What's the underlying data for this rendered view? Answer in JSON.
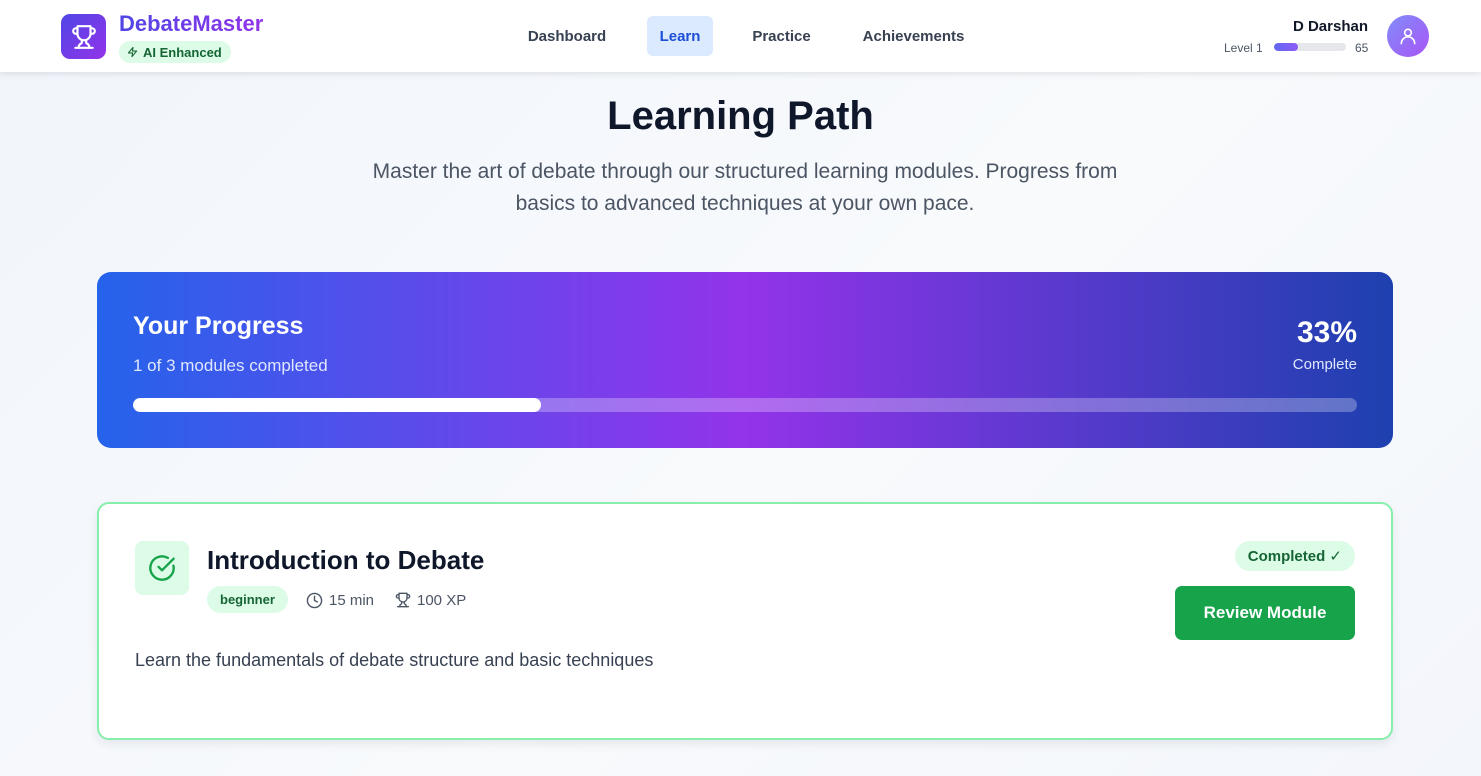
{
  "header": {
    "brand": "DebateMaster",
    "badge": "AI Enhanced",
    "nav": [
      {
        "label": "Dashboard",
        "active": false
      },
      {
        "label": "Learn",
        "active": true
      },
      {
        "label": "Practice",
        "active": false
      },
      {
        "label": "Achievements",
        "active": false
      }
    ],
    "user": {
      "name": "D Darshan",
      "level_label": "Level 1",
      "xp": "65",
      "level_progress": 0.33
    }
  },
  "page": {
    "title": "Learning Path",
    "subtitle": "Master the art of debate through our structured learning modules. Progress from basics to advanced techniques at your own pace."
  },
  "progress": {
    "title": "Your Progress",
    "subtitle": "1 of 3 modules completed",
    "percent_label": "33%",
    "complete_label": "Complete",
    "fraction": 0.333
  },
  "module": {
    "title": "Introduction to Debate",
    "level": "beginner",
    "duration": "15 min",
    "xp": "100 XP",
    "description": "Learn the fundamentals of debate structure and basic techniques",
    "status": "Completed ✓",
    "button": "Review Module"
  },
  "colors": {
    "brand_gradient": [
      "#4f46e5",
      "#9333ea"
    ],
    "progress_gradient": [
      "#2563eb",
      "#9333ea",
      "#1e40af"
    ],
    "success": "#16a34a",
    "success_light": "#dcfce7"
  },
  "icons": {
    "logo": "trophy-icon",
    "badge": "lightning-icon",
    "avatar": "user-icon",
    "module_status": "check-circle-icon",
    "duration": "clock-icon",
    "xp": "trophy-icon"
  }
}
